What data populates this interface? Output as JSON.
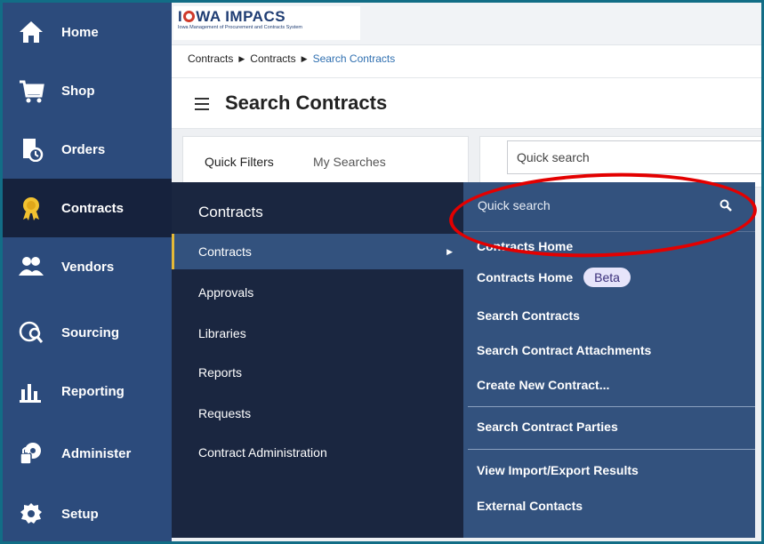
{
  "nav": {
    "items": [
      {
        "label": "Home",
        "icon": "home-icon"
      },
      {
        "label": "Shop",
        "icon": "cart-icon"
      },
      {
        "label": "Orders",
        "icon": "orders-icon"
      },
      {
        "label": "Contracts",
        "icon": "award-icon",
        "active": true
      },
      {
        "label": "Vendors",
        "icon": "vendors-icon"
      },
      {
        "label": "Sourcing",
        "icon": "sourcing-icon"
      },
      {
        "label": "Reporting",
        "icon": "chart-icon"
      },
      {
        "label": "Administer",
        "icon": "admin-icon"
      },
      {
        "label": "Setup",
        "icon": "gear-icon"
      }
    ]
  },
  "logo": {
    "title_part1": "I",
    "title_part2": "WA IMPACS",
    "subtitle": "Iowa Management of Procurement and Contracts System"
  },
  "breadcrumb": [
    "Contracts",
    "Contracts",
    "Search Contracts"
  ],
  "page": {
    "title": "Search Contracts",
    "quick_filters": "Quick Filters",
    "my_searches": "My Searches",
    "search_placeholder": "Quick search"
  },
  "menu": {
    "title": "Contracts",
    "items": [
      "Contracts",
      "Approvals",
      "Libraries",
      "Reports",
      "Requests",
      "Contract Administration"
    ],
    "sub": {
      "search_placeholder": "Quick search",
      "items": [
        "Contracts Home",
        "Contracts Home",
        "Search Contracts",
        "Search Contract Attachments",
        "Create New Contract...",
        "Search Contract Parties",
        "View Import/Export Results",
        "External Contacts"
      ],
      "beta_badge": "Beta"
    }
  },
  "colors": {
    "nav_bg": "#2c4b7c",
    "nav_active": "#16223d",
    "menu_bg": "#1a2640",
    "submenu_bg": "#33527e",
    "annotation": "#e30000",
    "frame": "#126d86"
  }
}
